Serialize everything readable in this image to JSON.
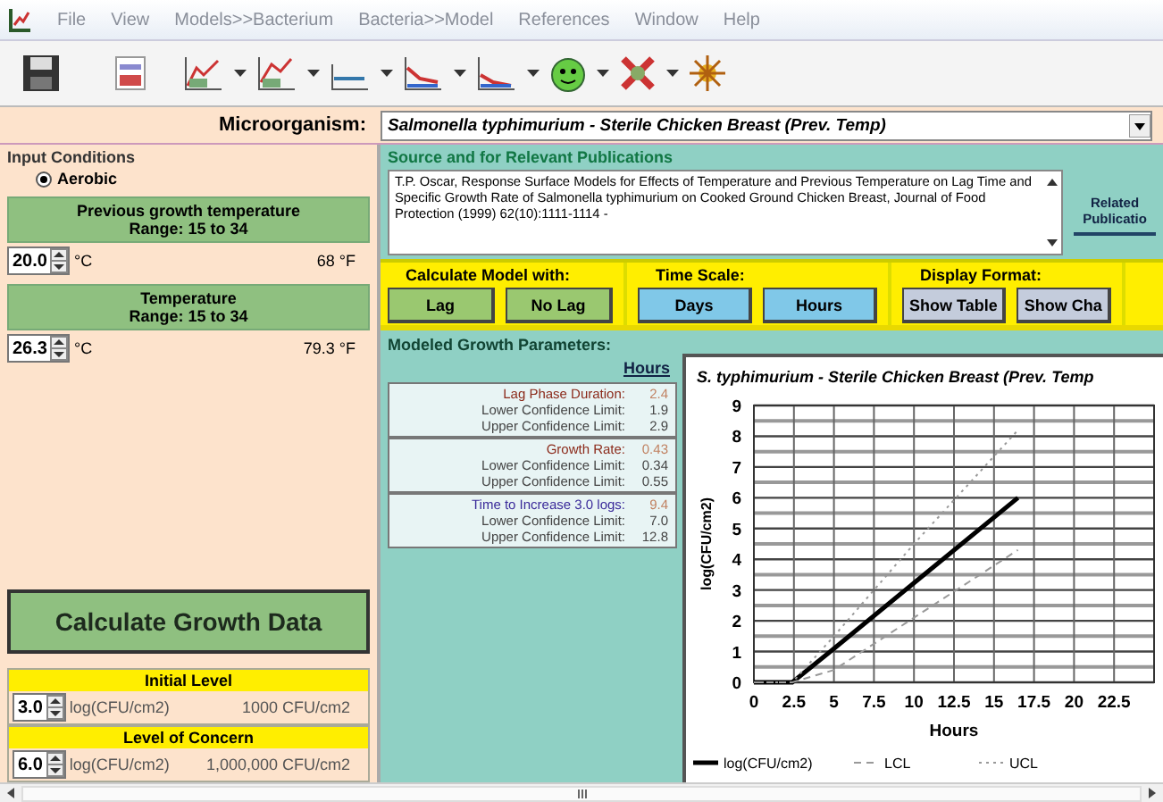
{
  "menu": [
    "File",
    "View",
    "Models>>Bacterium",
    "Bacteria>>Model",
    "References",
    "Window",
    "Help"
  ],
  "microorganism": {
    "label": "Microorganism:",
    "value": "Salmonella typhimurium - Sterile Chicken Breast (Prev. Temp)"
  },
  "input_conditions": {
    "title": "Input Conditions",
    "options": [
      {
        "label": "Aerobic",
        "selected": true
      }
    ]
  },
  "temperatures": [
    {
      "title": "Previous growth temperature",
      "range": "Range: 15 to 34",
      "value": "20.0",
      "unit": "°C",
      "converted": "68 °F"
    },
    {
      "title": "Temperature",
      "range": "Range: 15 to 34",
      "value": "26.3",
      "unit": "°C",
      "converted": "79.3 °F"
    }
  ],
  "calculate_button": "Calculate Growth Data",
  "levels": [
    {
      "title": "Initial Level",
      "value": "3.0",
      "unit": "log(CFU/cm2)",
      "converted": "1000 CFU/cm2"
    },
    {
      "title": "Level of Concern",
      "value": "6.0",
      "unit": "log(CFU/cm2)",
      "converted": "1,000,000 CFU/cm2"
    }
  ],
  "source": {
    "title": "Source and for Relevant Publications",
    "citation": "T.P. Oscar, Response Surface Models for Effects of Temperature and Previous Temperature on Lag Time and Specific Growth Rate of Salmonella typhimurium on Cooked Ground Chicken Breast, Journal of Food Protection (1999) 62(10):1111-1114 -",
    "related_button": "Related Publicatio"
  },
  "controls": [
    {
      "title": "Calculate Model with:",
      "kind": "model",
      "buttons": [
        "Lag",
        "No Lag"
      ]
    },
    {
      "title": "Time Scale:",
      "kind": "scale",
      "buttons": [
        "Days",
        "Hours"
      ]
    },
    {
      "title": "Display Format:",
      "kind": "format",
      "buttons": [
        "Show Table",
        "Show Cha"
      ]
    }
  ],
  "parameters": {
    "title": "Modeled Growth Parameters:",
    "unit_link": "Hours",
    "groups": [
      {
        "label": "Lag Phase Duration:",
        "value": "2.4",
        "color": "#8b2a1a",
        "rows": [
          {
            "label": "Lower Confidence Limit:",
            "value": "1.9"
          },
          {
            "label": "Upper Confidence Limit:",
            "value": "2.9"
          }
        ]
      },
      {
        "label": "Growth Rate:",
        "value": "0.43",
        "color": "#8b2a1a",
        "rows": [
          {
            "label": "Lower Confidence Limit:",
            "value": "0.34"
          },
          {
            "label": "Upper Confidence Limit:",
            "value": "0.55"
          }
        ]
      },
      {
        "label": "Time to Increase 3.0 logs:",
        "value": "9.4",
        "color": "#3a2a9a",
        "rows": [
          {
            "label": "Lower Confidence Limit:",
            "value": "7.0"
          },
          {
            "label": "Upper Confidence Limit:",
            "value": "12.8"
          }
        ]
      }
    ]
  },
  "chart": {
    "chart_data": {
      "type": "line",
      "title": "S. typhimurium - Sterile Chicken Breast (Prev. Temp",
      "xlabel": "Hours",
      "ylabel": "log(CFU/cm2)",
      "x": [
        0,
        2.4,
        5,
        10,
        16.5
      ],
      "series": [
        {
          "name": "log(CFU/cm2)",
          "color": "#000000",
          "line_style": "solid",
          "values": [
            0,
            0,
            1.1,
            3.23,
            6
          ]
        },
        {
          "name": "LCL",
          "color": "#999999",
          "line_style": "dashed",
          "values": [
            0,
            0,
            0.4,
            2.1,
            4.3
          ]
        },
        {
          "name": "UCL",
          "color": "#999999",
          "line_style": "dotted",
          "values": [
            0,
            0,
            1.5,
            4.5,
            8.2
          ]
        }
      ],
      "grid": true,
      "legend": true,
      "xlim": [
        0,
        25
      ],
      "ylim": [
        0,
        9
      ],
      "xticks": [
        0,
        2.5,
        5,
        7.5,
        10,
        12.5,
        15,
        17.5,
        20,
        22.5
      ],
      "yticks": [
        0,
        1,
        2,
        3,
        4,
        5,
        6,
        7,
        8,
        9
      ]
    }
  }
}
